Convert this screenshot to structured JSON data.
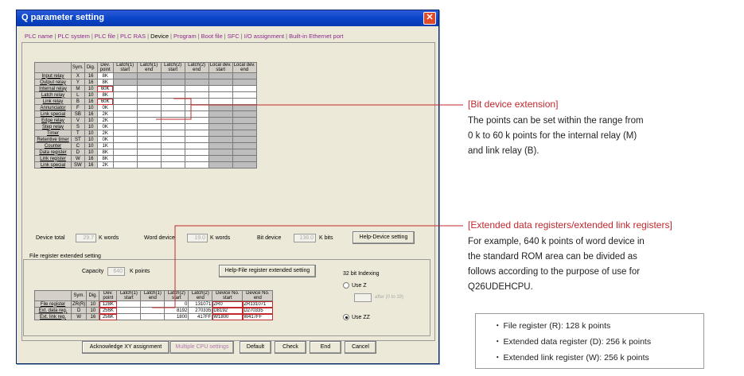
{
  "window": {
    "title": "Q parameter setting",
    "close_glyph": "✕"
  },
  "tabs": [
    "PLC name",
    "PLC system",
    "PLC file",
    "PLC RAS",
    "Device",
    "Program",
    "Boot file",
    "SFC",
    "I/O assignment",
    "Built-in Ethernet port"
  ],
  "active_tab": "Device",
  "device_table": {
    "headers": [
      "Sym.",
      "Dig.",
      "Dev. point",
      "Latch(1) start",
      "Latch(1) end",
      "Latch(2) start",
      "Latch(2) end",
      "Local dev. start",
      "Local dev. end"
    ],
    "rows": [
      {
        "name": "Input relay",
        "sym": "X",
        "dig": "16",
        "point": "8K"
      },
      {
        "name": "Output relay",
        "sym": "Y",
        "dig": "16",
        "point": "8K"
      },
      {
        "name": "Internal relay",
        "sym": "M",
        "dig": "10",
        "point": "60K"
      },
      {
        "name": "Latch relay",
        "sym": "L",
        "dig": "10",
        "point": "8K"
      },
      {
        "name": "Link relay",
        "sym": "B",
        "dig": "16",
        "point": "60K"
      },
      {
        "name": "Annunciator",
        "sym": "F",
        "dig": "10",
        "point": "0K"
      },
      {
        "name": "Link special",
        "sym": "SB",
        "dig": "16",
        "point": "2K"
      },
      {
        "name": "Edge relay",
        "sym": "V",
        "dig": "10",
        "point": "2K"
      },
      {
        "name": "Step relay",
        "sym": "S",
        "dig": "10",
        "point": "0K"
      },
      {
        "name": "Timer",
        "sym": "T",
        "dig": "10",
        "point": "2K"
      },
      {
        "name": "Retentive timer",
        "sym": "ST",
        "dig": "10",
        "point": "0K"
      },
      {
        "name": "Counter",
        "sym": "C",
        "dig": "10",
        "point": "1K"
      },
      {
        "name": "Data register",
        "sym": "D",
        "dig": "10",
        "point": "8K"
      },
      {
        "name": "Link register",
        "sym": "W",
        "dig": "16",
        "point": "8K"
      },
      {
        "name": "Link special",
        "sym": "SW",
        "dig": "16",
        "point": "2K"
      }
    ]
  },
  "totals": {
    "device_total_label": "Device total",
    "device_total_value": "29.7",
    "device_total_unit": "K words",
    "word_device_label": "Word device",
    "word_device_value": "19.0",
    "word_device_unit": "K words",
    "bit_device_label": "Bit device",
    "bit_device_value": "138.0",
    "bit_device_unit": "K bits",
    "help_device_button": "Help-Device setting"
  },
  "file_register": {
    "group_label": "File register extended setting",
    "capacity_label": "Capacity",
    "capacity_value": "640",
    "capacity_unit": "K points",
    "help_button": "Help-File register extended setting",
    "headers": [
      "Sym.",
      "Dig.",
      "Dev. point",
      "Latch(1) start",
      "Latch(1) end",
      "Latch(2) start",
      "Latch(2) end",
      "Device No. start",
      "Device No. end"
    ],
    "rows": [
      {
        "name": "File register",
        "sym": "ZR(R)",
        "dig": "10",
        "point": "128K",
        "l2s": "0",
        "l2e": "131071",
        "dns": "ZR0",
        "dne": "ZR131071"
      },
      {
        "name": "Ext. data reg.",
        "sym": "D",
        "dig": "10",
        "point": "256K",
        "l2s": "8192",
        "l2e": "270335",
        "dns": "D8192",
        "dne": "D270335"
      },
      {
        "name": "Ext. link reg.",
        "sym": "W",
        "dig": "16",
        "point": "256K",
        "l2s": "1800",
        "l2e": "417FF",
        "dns": "W1800",
        "dne": "W417FF"
      }
    ]
  },
  "indexing": {
    "label": "32 bit Indexing",
    "use_z": "Use Z",
    "after_label": "after (0 to 19)",
    "use_zz": "Use ZZ"
  },
  "bottom_buttons": {
    "acknowledge": "Acknowledge XY assignment",
    "multiple_cpu": "Multiple CPU settings",
    "default": "Default",
    "check": "Check",
    "end": "End",
    "cancel": "Cancel"
  },
  "annotation_bit": {
    "title": "[Bit device extension]",
    "body": [
      "The points can be set within the range from",
      "0 k to 60 k points for the internal relay (M)",
      "and link relay (B)."
    ]
  },
  "annotation_ext": {
    "title": "[Extended data registers/extended link registers]",
    "body": [
      "For example, 640 k points of word device in",
      "the standard ROM area can be divided as",
      "follows according to the purpose of use for",
      "Q26UDEHCPU."
    ],
    "list": [
      "File register (R): 128 k points",
      "Extended data register (D): 256 k points",
      "Extended link register (W): 256 k points"
    ]
  },
  "colors": {
    "accent_red": "#c0292d",
    "title_blue": "#0a45c8"
  }
}
